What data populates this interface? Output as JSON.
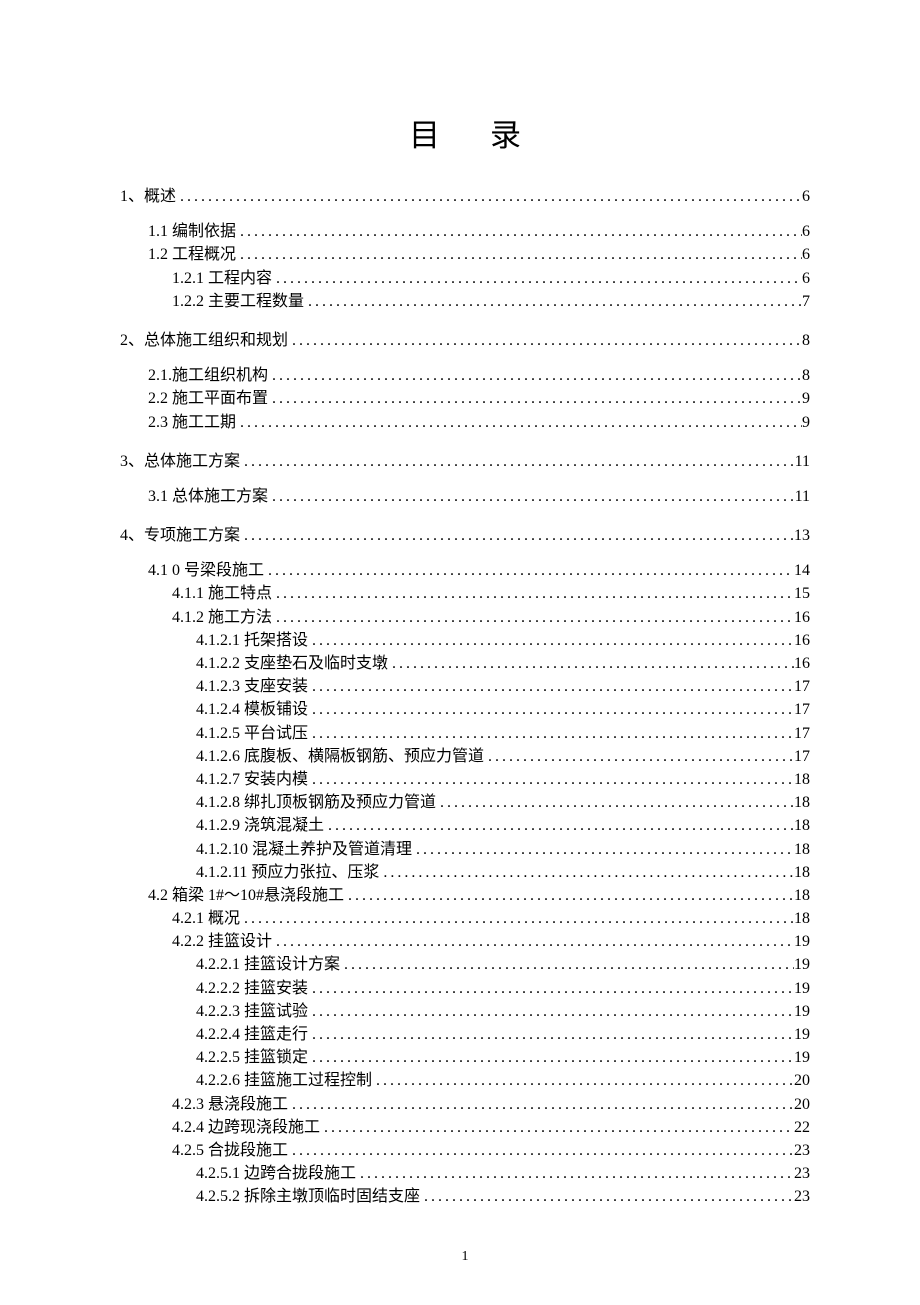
{
  "title": "目录",
  "page_number": "1",
  "toc": [
    {
      "level": 0,
      "label": "1、概述",
      "page": "6"
    },
    {
      "level": 1,
      "label": "1.1 编制依据",
      "page": "6",
      "blockStart": true
    },
    {
      "level": 1,
      "label": "1.2 工程概况",
      "page": "6"
    },
    {
      "level": 2,
      "label": "1.2.1 工程内容",
      "page": "6"
    },
    {
      "level": 2,
      "label": "1.2.2 主要工程数量",
      "page": "7"
    },
    {
      "level": 0,
      "label": "2、总体施工组织和规划",
      "page": "8"
    },
    {
      "level": 1,
      "label": "2.1.施工组织机构",
      "page": "8",
      "blockStart": true
    },
    {
      "level": 1,
      "label": "2.2 施工平面布置",
      "page": "9"
    },
    {
      "level": 1,
      "label": "2.3 施工工期",
      "page": "9"
    },
    {
      "level": 0,
      "label": "3、总体施工方案",
      "page": "11"
    },
    {
      "level": 1,
      "label": "3.1 总体施工方案",
      "page": "11",
      "blockStart": true
    },
    {
      "level": 0,
      "label": "4、专项施工方案",
      "page": "13"
    },
    {
      "level": 1,
      "label": "4.1 0 号梁段施工",
      "page": "14",
      "blockStart": true
    },
    {
      "level": 2,
      "label": "4.1.1 施工特点",
      "page": "15"
    },
    {
      "level": 2,
      "label": "4.1.2 施工方法",
      "page": "16"
    },
    {
      "level": 3,
      "label": "4.1.2.1 托架搭设",
      "page": "16"
    },
    {
      "level": 3,
      "label": "4.1.2.2 支座垫石及临时支墩",
      "page": "16"
    },
    {
      "level": 3,
      "label": "4.1.2.3 支座安装",
      "page": "17"
    },
    {
      "level": 3,
      "label": "4.1.2.4 模板铺设",
      "page": "17"
    },
    {
      "level": 3,
      "label": "4.1.2.5 平台试压",
      "page": "17"
    },
    {
      "level": 3,
      "label": "4.1.2.6 底腹板、横隔板钢筋、预应力管道",
      "page": "17"
    },
    {
      "level": 3,
      "label": "4.1.2.7 安装内模",
      "page": "18"
    },
    {
      "level": 3,
      "label": "4.1.2.8 绑扎顶板钢筋及预应力管道",
      "page": "18"
    },
    {
      "level": 3,
      "label": "4.1.2.9 浇筑混凝土",
      "page": "18"
    },
    {
      "level": 3,
      "label": "4.1.2.10 混凝土养护及管道清理",
      "page": "18"
    },
    {
      "level": 3,
      "label": "4.1.2.11 预应力张拉、压浆",
      "page": "18"
    },
    {
      "level": 1,
      "label": "4.2 箱梁 1#～10#悬浇段施工",
      "page": "18"
    },
    {
      "level": 2,
      "label": "4.2.1 概况",
      "page": "18"
    },
    {
      "level": 2,
      "label": "4.2.2 挂篮设计",
      "page": "19"
    },
    {
      "level": 3,
      "label": "4.2.2.1 挂篮设计方案",
      "page": "19"
    },
    {
      "level": 3,
      "label": "4.2.2.2 挂篮安装",
      "page": "19"
    },
    {
      "level": 3,
      "label": "4.2.2.3 挂篮试验",
      "page": "19"
    },
    {
      "level": 3,
      "label": "4.2.2.4 挂篮走行",
      "page": "19"
    },
    {
      "level": 3,
      "label": "4.2.2.5 挂篮锁定",
      "page": "19"
    },
    {
      "level": 3,
      "label": "4.2.2.6 挂篮施工过程控制",
      "page": "20"
    },
    {
      "level": 2,
      "label": "4.2.3 悬浇段施工",
      "page": "20"
    },
    {
      "level": 2,
      "label": "4.2.4 边跨现浇段施工",
      "page": "22"
    },
    {
      "level": 2,
      "label": "4.2.5 合拢段施工",
      "page": "23"
    },
    {
      "level": 3,
      "label": "4.2.5.1 边跨合拢段施工",
      "page": "23"
    },
    {
      "level": 3,
      "label": "4.2.5.2 拆除主墩顶临时固结支座",
      "page": "23"
    }
  ]
}
